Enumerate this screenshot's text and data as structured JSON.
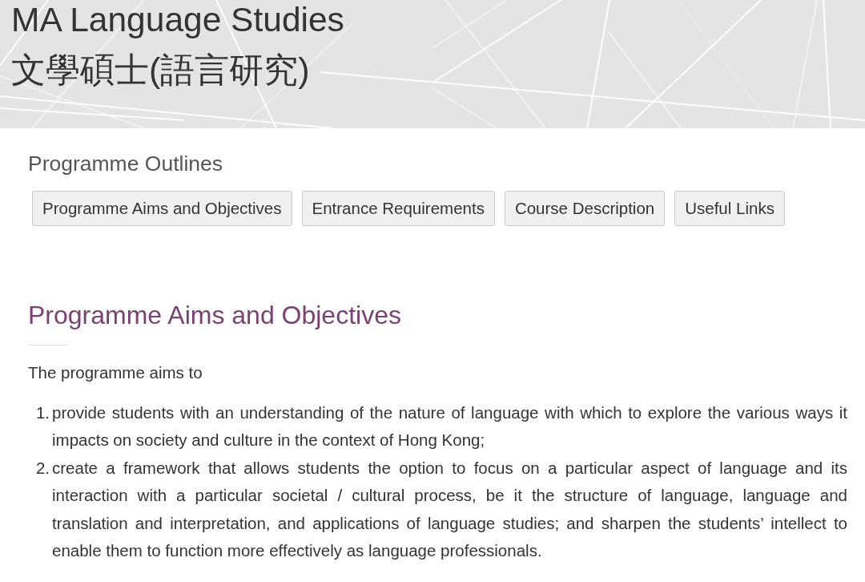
{
  "header": {
    "title": "MA Language Studies",
    "subtitle": "文學碩士(語言研究)"
  },
  "outline": {
    "heading": "Programme Outlines",
    "buttons": [
      "Programme Aims and Objectives",
      "Entrance Requirements",
      "Course Description",
      "Useful Links"
    ]
  },
  "section": {
    "heading": "Programme Aims and Objectives",
    "intro": "The programme aims to",
    "items": [
      {
        "number": "1.",
        "text": "provide students with an understanding of the nature of language with which to explore the various ways it impacts on society and culture in the context of Hong Kong;"
      },
      {
        "number": "2.",
        "text": "create a framework that allows students the option to focus on a particular aspect of language and its interaction with a particular societal / cultural process, be it the structure of language, language and translation and interpretation, and applications of language studies; and sharpen the students’ intellect to enable them to function more effectively as language professionals."
      }
    ]
  }
}
